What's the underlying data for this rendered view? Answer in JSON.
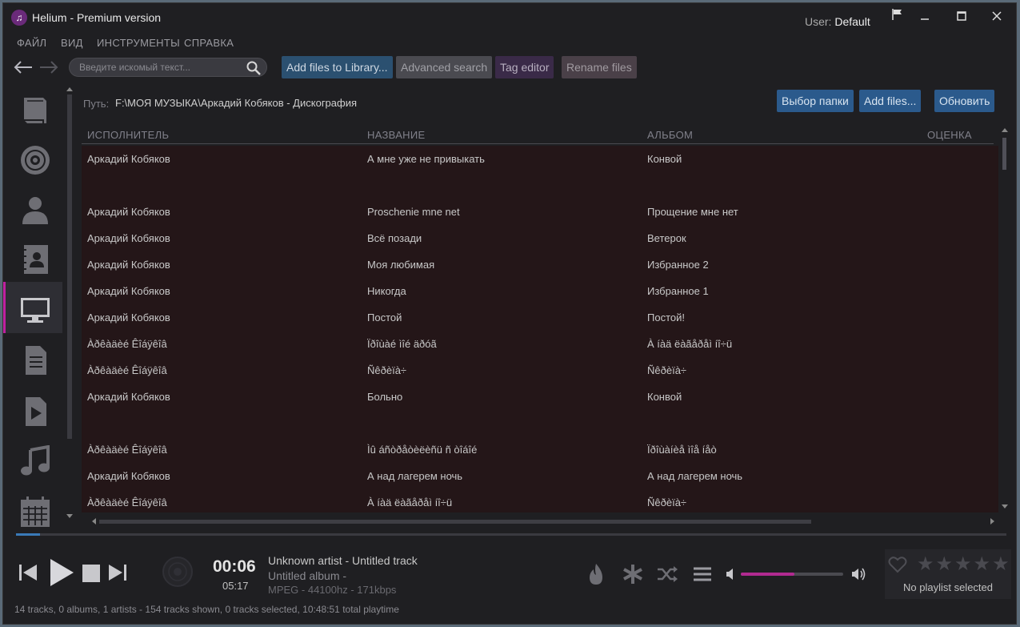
{
  "window": {
    "title": "Helium - Premium version",
    "user_label": "User:",
    "user_name": "Default"
  },
  "menu": [
    "ФАЙЛ",
    "ВИД",
    "ИНСТРУМЕНТЫ",
    "СПРАВКА"
  ],
  "search": {
    "placeholder": "Введите искомый текст..."
  },
  "toolbar": {
    "add_library": "Add files to Library...",
    "advanced_search": "Advanced search",
    "tag_editor": "Tag editor",
    "rename_files": "Rename files"
  },
  "path": {
    "label": "Путь:",
    "value": "F:\\МОЯ МУЗЫКА\\Аркадий Кобяков - Дискография",
    "choose_folder": "Выбор папки",
    "add_files": "Add files...",
    "refresh": "Обновить"
  },
  "table": {
    "headers": [
      "ИСПОЛНИТЕЛЬ",
      "НАЗВАНИЕ",
      "АЛЬБОМ",
      "ОЦЕНКА"
    ],
    "rows": [
      [
        "Аркадий Кобяков",
        "А мне уже не привыкать",
        "Конвой"
      ],
      [
        "",
        "",
        ""
      ],
      [
        "Аркадий Кобяков",
        "Proschenie mne net",
        "Прощение мне нет"
      ],
      [
        "Аркадий Кобяков",
        "Всё позади",
        "Ветерок"
      ],
      [
        "Аркадий Кобяков",
        "Моя любимая",
        "Избранное 2"
      ],
      [
        "Аркадий Кобяков",
        "Никогда",
        "Избранное 1"
      ],
      [
        "Аркадий Кобяков",
        "Постой",
        "Постой!"
      ],
      [
        "Àðêàäèé Êîáÿêîâ",
        "Ïðîùàé ìîé äðóã",
        "À íàä ëàãåðåì íî÷ü"
      ],
      [
        "Àðêàäèé Êîáÿêîâ",
        "Ñêðèïà÷",
        "Ñêðèïà÷"
      ],
      [
        "Аркадий Кобяков",
        "Больно",
        "Конвой"
      ],
      [
        "",
        "",
        ""
      ],
      [
        "Àðêàäèé Êîáÿêîâ",
        "Ìû áñòðåòèëèñü ñ òîáîé",
        "Ïðîùàíèå ìîå íåò"
      ],
      [
        "Аркадий Кобяков",
        "А над лагерем ночь",
        "А над лагерем ночь"
      ],
      [
        "Àðêàäèé Êîáÿêîâ",
        "À íàä ëàãåðåì íî÷ü",
        "Ñêðèïà÷"
      ]
    ]
  },
  "player": {
    "time_current": "00:06",
    "time_total": "05:17",
    "track_title": "Unknown artist - Untitled track",
    "track_album": "Untitled album -",
    "track_format": "MPEG - 44100hz - 171kbps",
    "progress": 0.024,
    "volume": 0.52,
    "playlist_status": "No playlist selected"
  },
  "status": "14 tracks, 0 albums, 1 artists - 154 tracks shown, 0 tracks selected, 10:48:51 total playtime",
  "colors": {
    "accent_blue": "#2b5a8c",
    "accent_magenta": "#b02a90",
    "row_bg": "#241618"
  }
}
